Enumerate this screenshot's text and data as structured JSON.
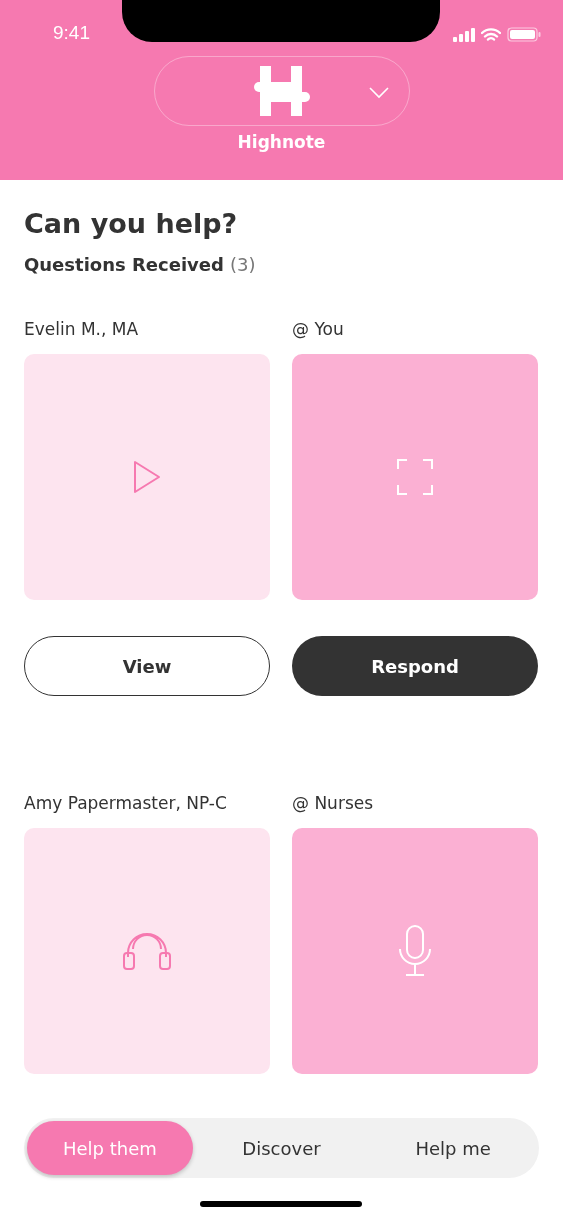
{
  "status_bar": {
    "time": "9:41"
  },
  "header": {
    "app_name": "Highnote"
  },
  "title": "Can you help?",
  "section": {
    "label": "Questions Received",
    "count": "(3)"
  },
  "questions": [
    {
      "sender": "Evelin M., MA",
      "recipient": "@ You",
      "sender_media": {
        "kind": "play"
      },
      "recipient_media": {
        "kind": "focus"
      },
      "actions": [
        {
          "label": "View",
          "kind": "outline"
        },
        {
          "label": "Respond",
          "kind": "filled"
        }
      ]
    },
    {
      "sender": "Amy Papermaster, NP-C",
      "recipient": "@ Nurses",
      "sender_media": {
        "kind": "headphones"
      },
      "recipient_media": {
        "kind": "mic"
      }
    }
  ],
  "tabs": [
    {
      "label": "Help them",
      "selected": true
    },
    {
      "label": "Discover",
      "selected": false
    },
    {
      "label": "Help me",
      "selected": false
    }
  ]
}
